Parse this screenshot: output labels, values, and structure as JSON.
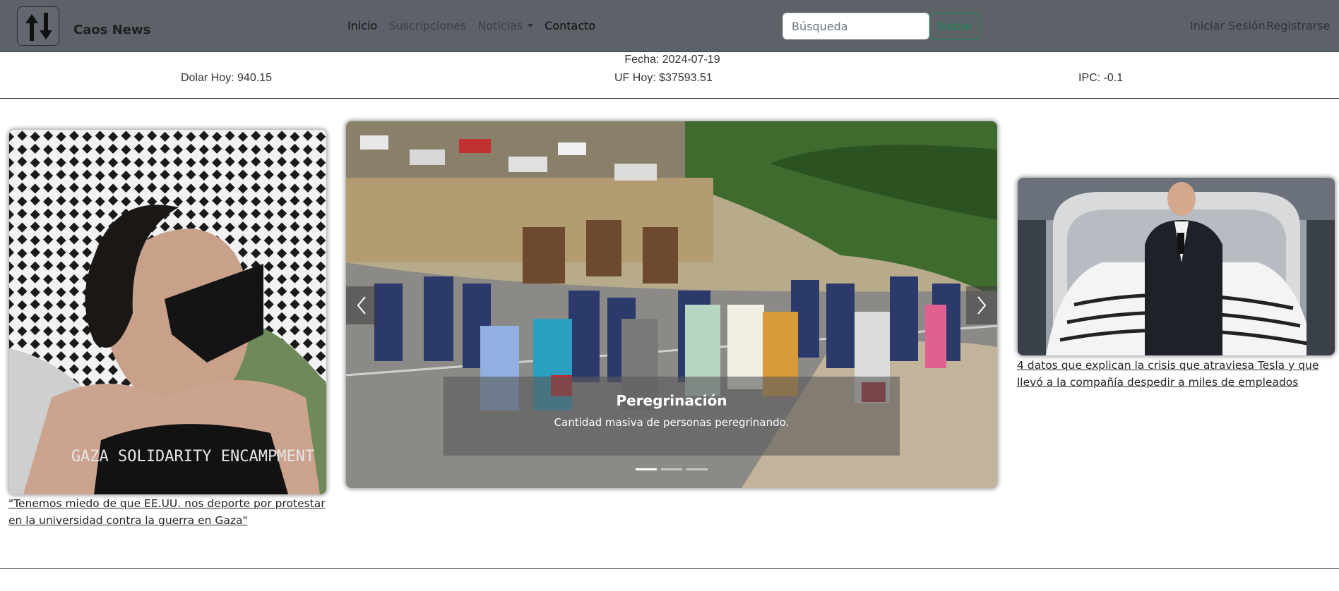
{
  "navbar": {
    "brand": "Caos News",
    "links": [
      {
        "label": "Inicio"
      },
      {
        "label": "Suscripciones"
      },
      {
        "label": "Noticias"
      },
      {
        "label": "Contacto"
      }
    ],
    "search_placeholder": "Búsqueda",
    "search_button": "Buscar",
    "login": "Iniciar Sesión",
    "register": "Registrarse"
  },
  "indicators": {
    "fecha": "Fecha: 2024-07-19",
    "dolar": "Dolar Hoy: 940.15",
    "uf": "UF Hoy: $37593.51",
    "ipc": "IPC: -0.1"
  },
  "news": {
    "left_link": "\"Tenemos miedo de que EE.UU. nos deporte por protestar en la universidad contra la guerra en Gaza\"",
    "left_shirt_text": "GAZA SOLIDARITY ENCAMPMENT",
    "right_link": "4 datos que explican la crisis que atraviesa Tesla y que llevó a la compañía despedir a miles de empleados"
  },
  "carousel": {
    "title": "Peregrinación",
    "caption": "Cantidad masiva de personas peregrinando.",
    "slides": 3,
    "active_slide": 1
  },
  "colors": {
    "navbar_bg": "#5d6168",
    "search_accent": "#198754"
  },
  "icons": [
    "arrows-up-down-icon",
    "chevron-left-icon",
    "chevron-right-icon",
    "caret-down-icon"
  ]
}
